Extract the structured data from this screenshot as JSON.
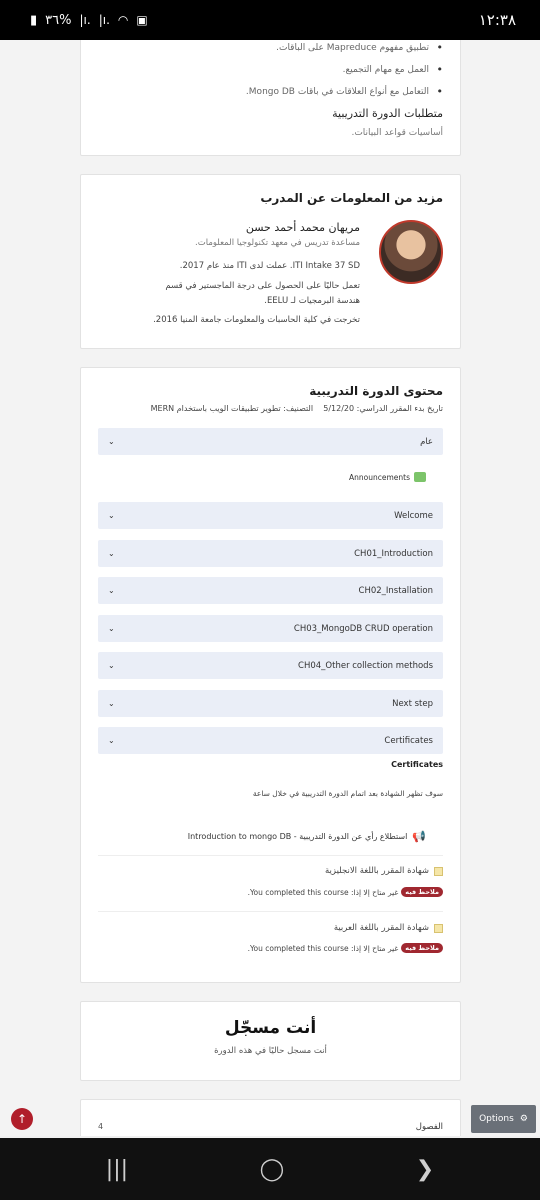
{
  "status": {
    "time": "١٢:٣٨",
    "battery": "٣٦%"
  },
  "objectives": {
    "bullets": [
      "تطبيق مفهوم Mapreduce على الباقات.",
      "العمل مع مهام التجميع.",
      "التعامل مع أنواع العلاقات في باقات Mongo DB."
    ],
    "requirements_title": "متطلبات الدورة التدريبية",
    "requirements_text": "أساسيات قواعد البيانات."
  },
  "instructor": {
    "title": "مزيد من المعلومات عن المدرب",
    "name": "مريهان محمد أحمد حسن",
    "role": "مساعدة تدريس في معهد تكنولوجيا المعلومات.",
    "bio": [
      "ITI Intake 37 SD. عملت لدى ITI منذ عام 2017.",
      "تعمل حاليًا على الحصول على درجة الماجستير في قسم هندسة البرمجيات لـ EELU.",
      "تخرجت في كلية الحاسبات والمعلومات جامعة المنيا 2016."
    ]
  },
  "content": {
    "title": "محتوى الدورة التدريبية",
    "meta": "تاريخ بدء المقرر الدراسي: 5/12/20    التصنيف: تطوير تطبيقات الويب باستخدام MERN",
    "general_label": "عام",
    "announcements": "Announcements",
    "sections": [
      "Welcome",
      "CH01_Introduction",
      "CH02_Installation",
      "CH03_MongoDB CRUD operation",
      "CH04_Other collection methods",
      "Next step",
      "Certificates"
    ],
    "certificates_heading": "Certificates",
    "certificates_note": "سوف تظهر الشهادة بعد اتمام الدورة التدريبية في خلال ساعة",
    "survey": "استطلاع رأي عن الدورة التدريبية - Introduction to mongo DB",
    "certs": [
      {
        "name": "شهادة المقرر باللغة الانجليزية",
        "badge": "ملاحظ فيه",
        "status": "غير متاح إلا إذا: You completed this course."
      },
      {
        "name": "شهادة المقرر باللغة العربية",
        "badge": "ملاحظ فيه",
        "status": "غير متاح إلا إذا: You completed this course."
      }
    ]
  },
  "enrolled": {
    "title": "أنت مسجّل",
    "text": "أنت مسجل حاليًا في هذه الدورة"
  },
  "stats": {
    "label": "الفصول",
    "value": "4"
  },
  "options": {
    "label": "Options"
  },
  "colors": {
    "accordion_bg": "#eaeef7",
    "badge_red": "#a02830",
    "accent_red": "#b01e2a"
  }
}
